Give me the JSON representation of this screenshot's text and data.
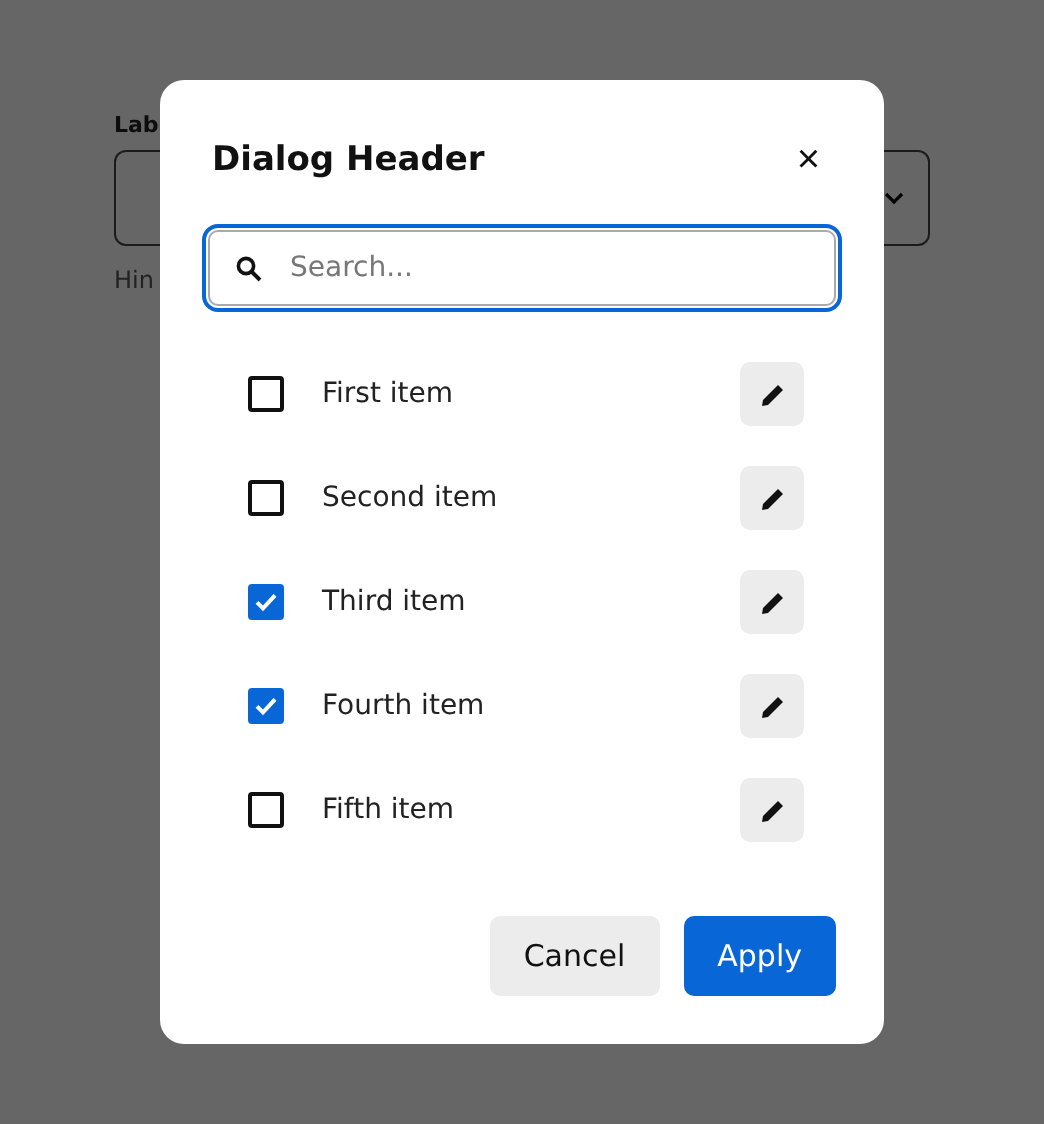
{
  "background_form": {
    "label": "Lab",
    "hint": "Hin"
  },
  "dialog": {
    "title": "Dialog Header",
    "close": "×",
    "search": {
      "placeholder": "Search..."
    },
    "items": [
      {
        "label": "First item",
        "checked": false
      },
      {
        "label": "Second item",
        "checked": false
      },
      {
        "label": "Third item",
        "checked": true
      },
      {
        "label": "Fourth item",
        "checked": true
      },
      {
        "label": "Fifth item",
        "checked": false
      }
    ],
    "buttons": [
      {
        "label": "Cancel",
        "kind": "secondary"
      },
      {
        "label": "Apply",
        "kind": "primary"
      }
    ]
  }
}
